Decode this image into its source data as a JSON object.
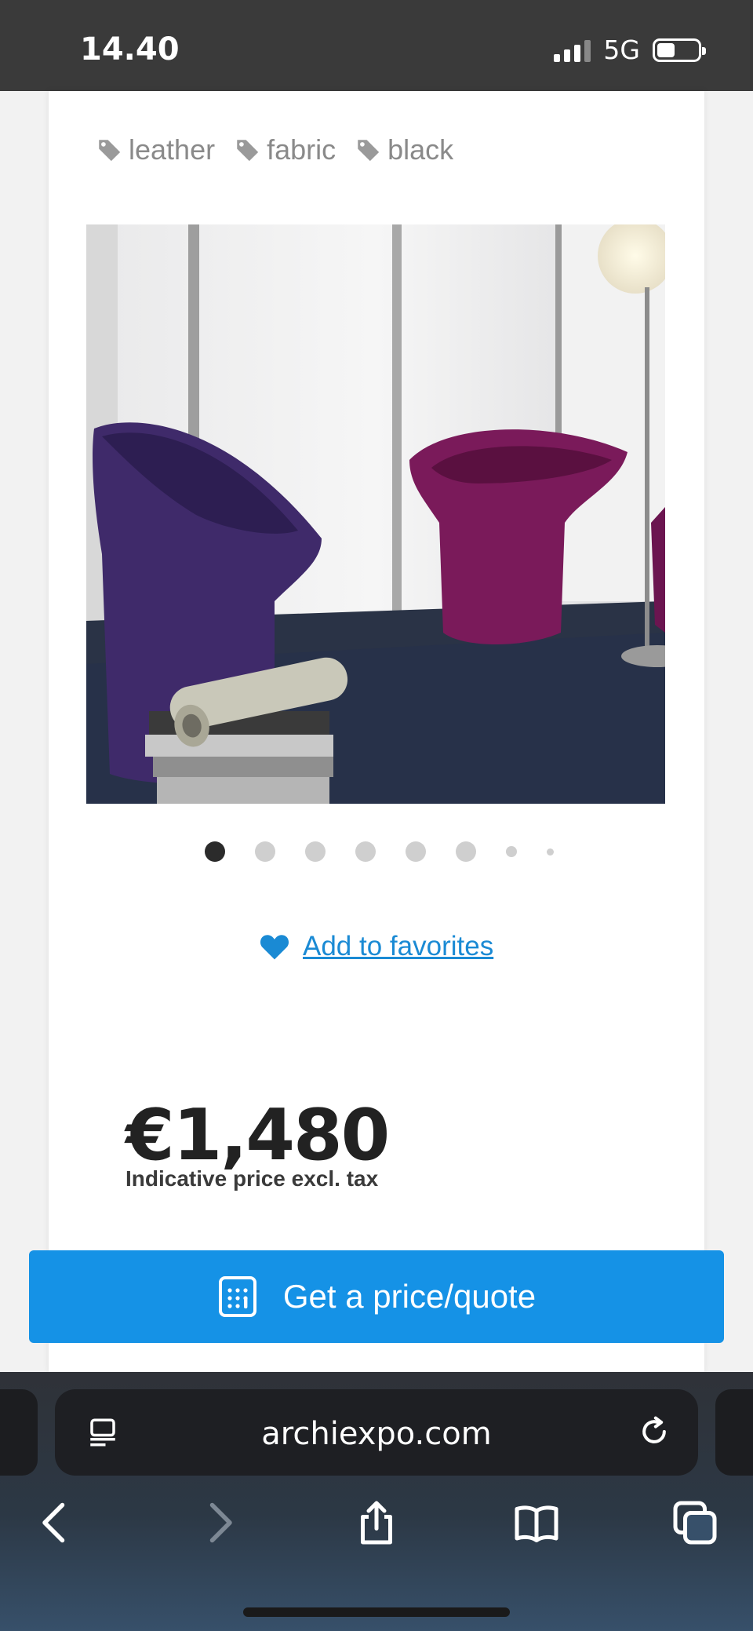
{
  "status": {
    "time": "14.40",
    "network": "5G"
  },
  "tags": [
    "leather",
    "fabric",
    "black"
  ],
  "carousel": {
    "total": 8,
    "active_index": 0
  },
  "favorites": {
    "label": "Add to favorites"
  },
  "price": {
    "value": "€1,480",
    "note": "Indicative price excl. tax"
  },
  "quote": {
    "label": "Get a price/quote"
  },
  "browser": {
    "url": "archiexpo.com"
  },
  "colors": {
    "accent": "#1592e6",
    "link": "#1a8ad4",
    "text": "#222222"
  }
}
